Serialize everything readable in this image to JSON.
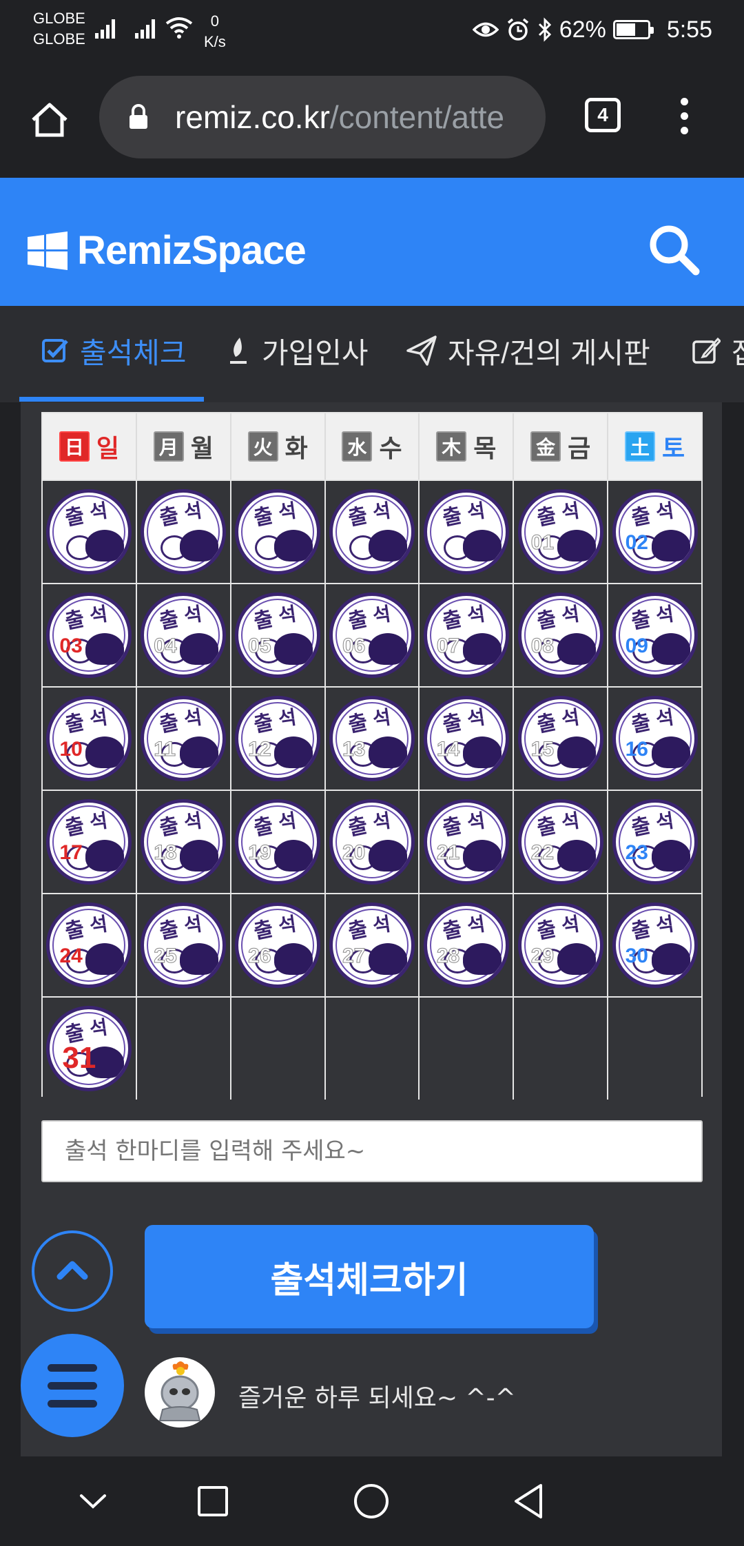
{
  "status_bar": {
    "carrier1": "GLOBE",
    "carrier2": "GLOBE",
    "net_speed_value": "0",
    "net_speed_unit": "K/s",
    "battery_percent": "62%",
    "battery_level": 0.62,
    "time": "5:55",
    "icons": [
      "signal-icon",
      "wifi-icon",
      "eye-icon",
      "alarm-icon",
      "bluetooth-icon",
      "battery-icon"
    ]
  },
  "browser": {
    "url_host": "remiz.co.kr",
    "url_path": "/content/atte",
    "tab_count": "4"
  },
  "site": {
    "logo_text": "RemizSpace"
  },
  "nav": {
    "items": [
      {
        "label": "출석체크",
        "icon": "checkbox-icon",
        "active": true
      },
      {
        "label": "가입인사",
        "icon": "leaf-icon",
        "active": false
      },
      {
        "label": "자유/건의 게시판",
        "icon": "paper-plane-icon",
        "active": false
      },
      {
        "label": "잡",
        "icon": "edit-icon",
        "active": false
      }
    ]
  },
  "calendar": {
    "weekdays": [
      {
        "kanji": "日",
        "label": "일"
      },
      {
        "kanji": "月",
        "label": "월"
      },
      {
        "kanji": "火",
        "label": "화"
      },
      {
        "kanji": "水",
        "label": "수"
      },
      {
        "kanji": "木",
        "label": "목"
      },
      {
        "kanji": "金",
        "label": "금"
      },
      {
        "kanji": "土",
        "label": "토"
      }
    ],
    "stamp_text": [
      "출",
      "석"
    ],
    "rows": [
      [
        "",
        "",
        "",
        "",
        "",
        "01",
        "02"
      ],
      [
        "03",
        "04",
        "05",
        "06",
        "07",
        "08",
        "09"
      ],
      [
        "10",
        "11",
        "12",
        "13",
        "14",
        "15",
        "16"
      ],
      [
        "17",
        "18",
        "19",
        "20",
        "21",
        "22",
        "23"
      ],
      [
        "24",
        "25",
        "26",
        "27",
        "28",
        "29",
        "30"
      ],
      [
        "31",
        null,
        null,
        null,
        null,
        null,
        null
      ]
    ]
  },
  "comment": {
    "placeholder": "출석 한마디를 입력해 주세요~"
  },
  "actions": {
    "check_button": "출석체크하기"
  },
  "greeting": "즐거운 하루 되세요~ ^-^"
}
